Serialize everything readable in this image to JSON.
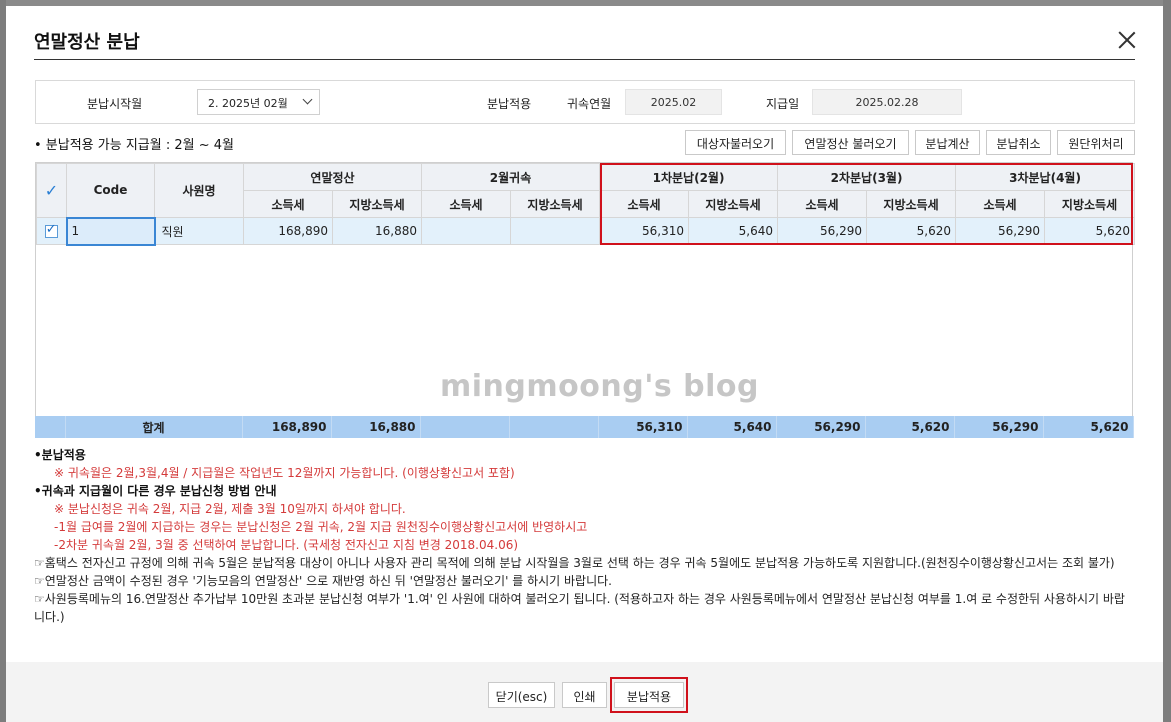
{
  "dialog": {
    "title": "연말정산 분납"
  },
  "filter": {
    "start_label": "분납시작월",
    "start_value": "2. 2025년 02월",
    "apply_label": "분납적용",
    "belong_label": "귀속연월",
    "belong_value": "2025.02",
    "pay_label": "지급일",
    "pay_value": "2025.02.28"
  },
  "note": "• 분납적용 가능 지급월 : 2월 ~ 4월",
  "toolbar": {
    "load_targets": "대상자불러오기",
    "load_yearend": "연말정산 불러오기",
    "calc": "분납계산",
    "cancel": "분납취소",
    "reset": "원단위처리"
  },
  "grid": {
    "headers": {
      "check": "✓",
      "code": "Code",
      "name": "사원명",
      "yearend": "연말정산",
      "feb_belong": "2월귀속",
      "inst1": "1차분납(2월)",
      "inst2": "2차분납(3월)",
      "inst3": "3차분납(4월)",
      "income_tax": "소득세",
      "local_tax": "지방소득세"
    },
    "rows": [
      {
        "code": "1",
        "name": "직원",
        "ye_income": "168,890",
        "ye_local": "16,880",
        "fb_income": "",
        "fb_local": "",
        "i1_income": "56,310",
        "i1_local": "5,640",
        "i2_income": "56,290",
        "i2_local": "5,620",
        "i3_income": "56,290",
        "i3_local": "5,620"
      }
    ],
    "watermark": "mingmoong's blog",
    "total": {
      "label": "합계",
      "ye_income": "168,890",
      "ye_local": "16,880",
      "fb_income": "",
      "fb_local": "",
      "i1_income": "56,310",
      "i1_local": "5,640",
      "i2_income": "56,290",
      "i2_local": "5,620",
      "i3_income": "56,290",
      "i3_local": "5,620"
    }
  },
  "notes": {
    "n1": "•분납적용",
    "n2": "※ 귀속월은 2월,3월,4월 / 지급월은 작업년도 12월까지 가능합니다. (이행상황신고서 포함)",
    "n3": "•귀속과 지급월이 다른 경우 분납신청 방법 안내",
    "n4": "※ 분납신청은 귀속 2월, 지급 2월, 제출 3월 10일까지 하셔야 합니다.",
    "n5": "-1월 급여를 2월에 지급하는 경우는 분납신청은 2월 귀속, 2월 지급 원천징수이행상황신고서에 반영하시고",
    "n6": "-2차분 귀속월 2월, 3월 중 선택하여 분납합니다. (국세청 전자신고 지침 변경 2018.04.06)",
    "n7": "☞홈택스 전자신고 규정에 의해 귀속 5월은 분납적용 대상이 아니나 사용자 관리 목적에 의해 분납 시작월을 3월로 선택 하는 경우 귀속 5월에도 분납적용 가능하도록 지원합니다.(원천징수이행상황신고서는 조회 불가)",
    "n8": "☞연말정산 금액이 수정된 경우 '기능모음의 연말정산' 으로 재반영 하신 뒤 '연말정산 불러오기' 를 하시기 바랍니다.",
    "n9": "☞사원등록메뉴의 16.연말정산 추가납부 10만원 초과분 분납신청 여부가 '1.여' 인 사원에 대하여 불러오기 됩니다. (적용하고자 하는 경우 사원등록메뉴에서 연말정산 분납신청 여부를 1.여 로 수정한뒤 사용하시기 바랍니다.)"
  },
  "footer": {
    "close": "닫기(esc)",
    "print": "인쇄",
    "apply": "분납적용"
  },
  "colors": {
    "highlight": "#d0111b",
    "total_row": "#a9cdf2",
    "selected_row": "#e3f1fb",
    "note_red": "#d43a3a"
  }
}
